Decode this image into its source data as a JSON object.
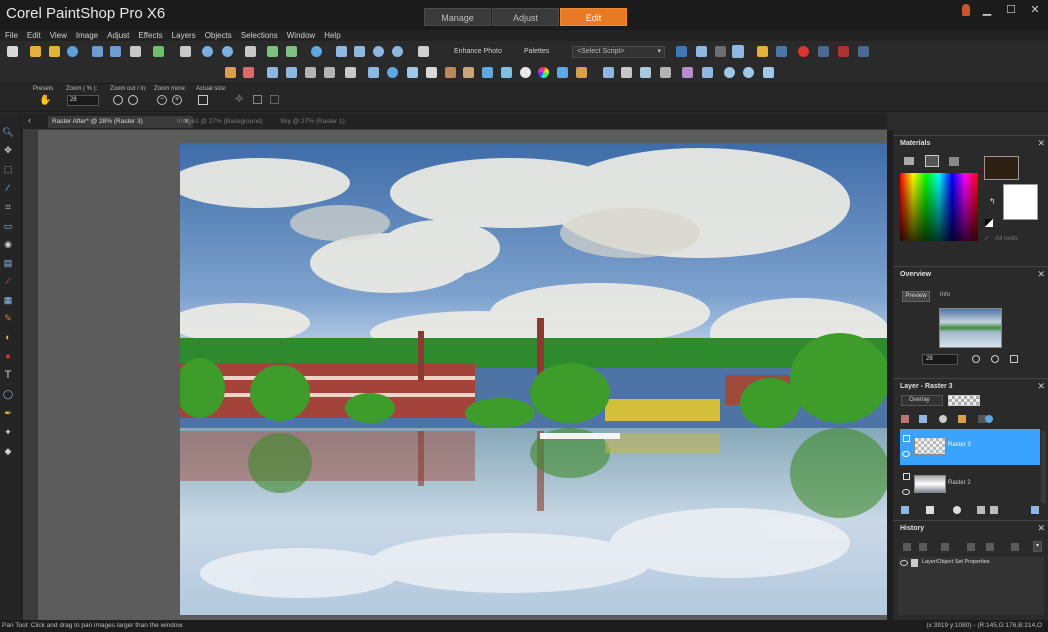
{
  "app": {
    "title": "Corel PaintShop Pro X6"
  },
  "workspace_tabs": [
    {
      "label": "Manage"
    },
    {
      "label": "Adjust"
    },
    {
      "label": "Edit"
    }
  ],
  "menu": [
    "File",
    "Edit",
    "View",
    "Image",
    "Adjust",
    "Effects",
    "Layers",
    "Objects",
    "Selections",
    "Window",
    "Help"
  ],
  "toolbar": {
    "enhance_photo": "Enhance Photo",
    "palettes": "Palettes",
    "select_script": "<Select Script>"
  },
  "tool_options": {
    "presets_label": "Presets",
    "zoom_label": "Zoom ( % ):",
    "zoom_value": "28",
    "zoom_out_in_label": "Zoom out / in:",
    "zoom_more_label": "Zoom more:",
    "actual_size_label": "Actual size:"
  },
  "documents": [
    {
      "label": "Raster After* @  28% (Raster 3)"
    },
    {
      "label": "Image1 @  27% (Background)"
    },
    {
      "label": "Sky @  27% (Raster 1)"
    }
  ],
  "materials": {
    "title": "Materials",
    "all_tools": "All tools"
  },
  "overview": {
    "title": "Overview",
    "tab_preview": "Preview",
    "tab_info": "Info",
    "zoom_value": "28"
  },
  "layers": {
    "title": "Layer - Raster 3",
    "blend_mode": "Overlay",
    "items": [
      {
        "name": "Raster 3"
      },
      {
        "name": "Raster 2"
      }
    ]
  },
  "history": {
    "title": "History",
    "items": [
      "Layer/Object Set Properties"
    ]
  },
  "status": {
    "left": "Pan Tool: Click and drag to pan images larger than the window.",
    "right": "(x:3919 y:1080) - (R:145,G:176,B:214,O"
  },
  "colors": {
    "accent": "#e77a22",
    "selection": "#3aa2ff",
    "foreground": "#2e2114",
    "background": "#ffffff"
  }
}
